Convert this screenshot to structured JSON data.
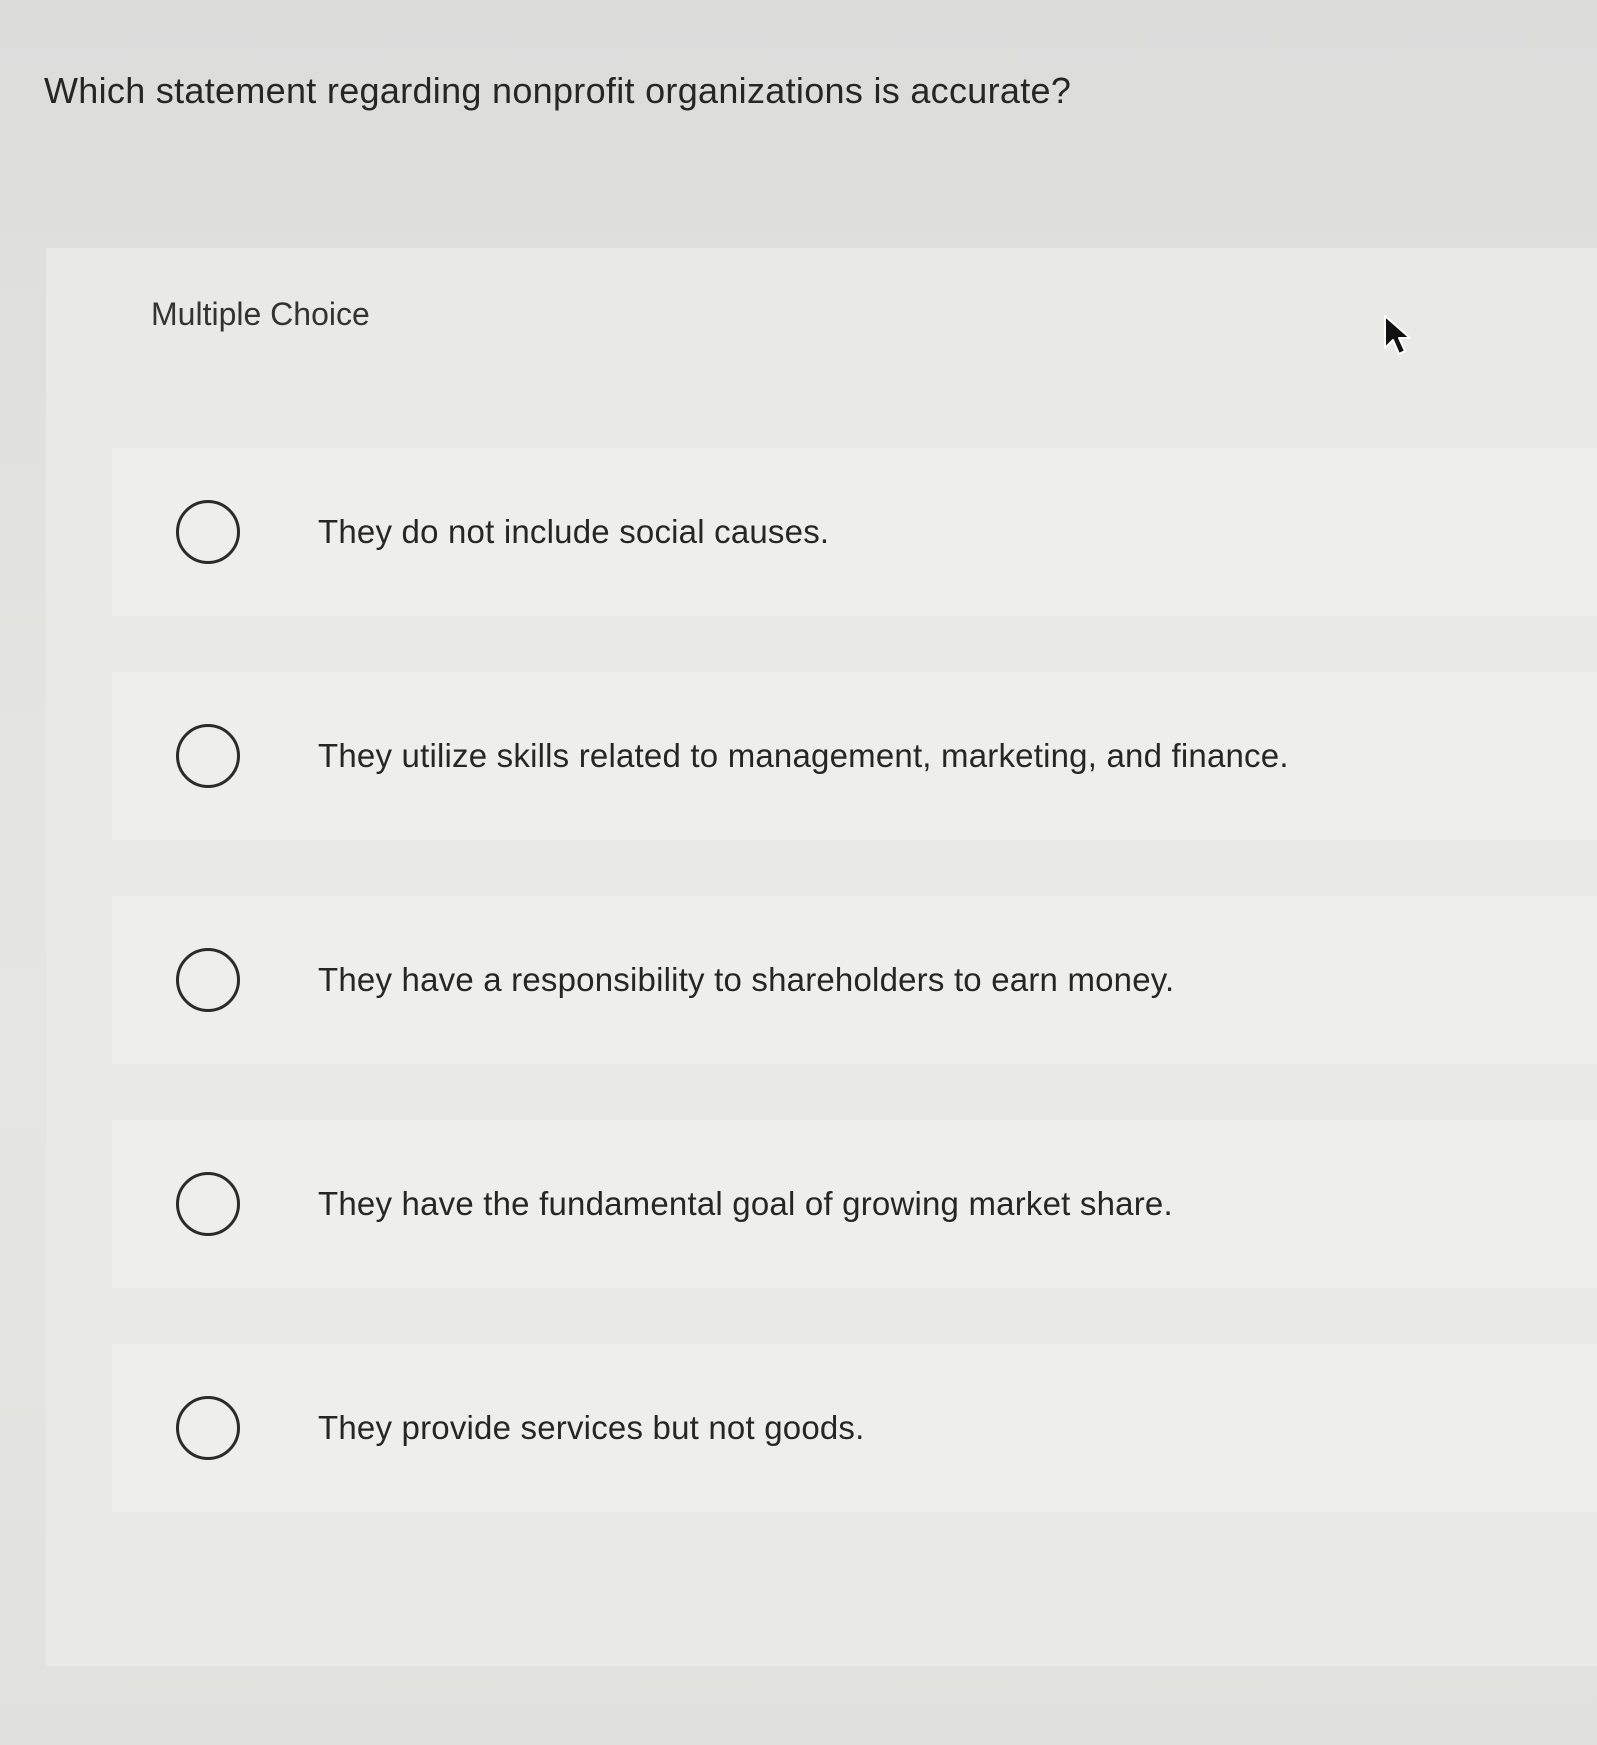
{
  "question": {
    "text": "Which statement regarding nonprofit organizations is accurate?"
  },
  "panel": {
    "type_label": "Multiple Choice",
    "options": [
      {
        "label": "They do not include social causes.",
        "selected": false
      },
      {
        "label": "They utilize skills related to management, marketing, and finance.",
        "selected": false
      },
      {
        "label": "They have a responsibility to shareholders to earn money.",
        "selected": false
      },
      {
        "label": "They have the fundamental goal of growing market share.",
        "selected": false
      },
      {
        "label": "They provide services but not goods.",
        "selected": false
      }
    ]
  },
  "icons": {
    "cursor": "mouse-pointer-icon",
    "radio": "radio-button-icon"
  },
  "colors": {
    "text": "#262626",
    "radio_border": "#2b2b2b",
    "panel_bg": "#e9e9e7",
    "option_bg": "#eeeeec"
  }
}
